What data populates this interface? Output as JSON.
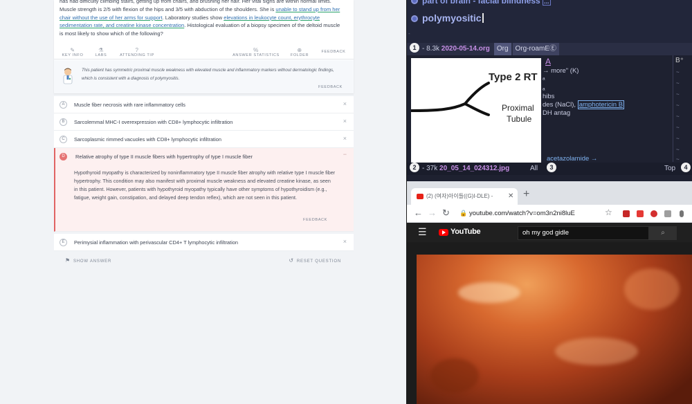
{
  "question": {
    "stem_parts": [
      {
        "text": "has had difficulty climbing stairs, getting up from chairs, and brushing her hair. Her vital signs are within normal limits. Muscle strength is 2/5 with flexion of the hips and 3/5 with abduction of the shoulders. She is ",
        "hl": false
      },
      {
        "text": "unable to stand up from her chair without the use of her arms for support",
        "hl": true
      },
      {
        "text": ". Laboratory studies show ",
        "hl": false
      },
      {
        "text": "elevations in leukocyte count, erythrocyte sedimentation rate, and creatine kinase concentration",
        "hl": true
      },
      {
        "text": ". Histological evaluation of a biopsy specimen of the deltoid muscle is most likely to show which of the following?",
        "hl": false
      }
    ],
    "toolbar": {
      "key_info": "KEY INFO",
      "labs": "LABS",
      "attending_tip": "ATTENDING TIP",
      "answer_statistics": "ANSWER STATISTICS",
      "folder": "FOLDER",
      "feedback": "FEEDBACK"
    },
    "explanation": "This patient has symmetric proximal muscle weakness with elevated muscle and inflammatory markers without dermatologic findings, which is consistent with a diagnosis of polymyositis.",
    "explanation_feedback": "FEEDBACK"
  },
  "answers": [
    {
      "letter": "A",
      "text": "Muscle fiber necrosis with rare inflammatory cells"
    },
    {
      "letter": "B",
      "text": "Sarcolemmal MHC-I overexpression with CD8+ lymphocytic infiltration"
    },
    {
      "letter": "C",
      "text": "Sarcoplasmic rimmed vacuoles with CD8+ lymphocytic infiltration"
    },
    {
      "letter": "D",
      "text": "Relative atrophy of type II muscle fibers with hypertrophy of type I muscle fiber",
      "selected": true,
      "explanation": "Hypothyroid myopathy is characterized by noninflammatory type II muscle fiber atrophy with relative type I muscle fiber hypertrophy. This condition may also manifest with proximal muscle weakness and elevated creatine kinase, as seen in this patient. However, patients with hypothyroid myopathy typically have other symptoms of hypothyroidism (e.g., fatigue, weight gain, constipation, and delayed deep tendon reflex), which are not seen in this patient.",
      "feedback": "FEEDBACK"
    },
    {
      "letter": "E",
      "text": "Perimysial inflammation with perivascular CD4+ T lymphocytic infiltration"
    }
  ],
  "bottom": {
    "show_answer": "SHOW ANSWER",
    "reset_question": "RESET QUESTION"
  },
  "emacs": {
    "heading1": "part of brain - facial blindness",
    "heading1_suffix": "...",
    "heading2": "polymyositic",
    "modeline1": {
      "window_num": "1",
      "size": "- 8.3k",
      "file": "2020-05-14.org",
      "mode": "Org",
      "minor": "Org-roam",
      "minor_suffix": "EⒺ"
    },
    "image_labels": {
      "title": "Type 2 RT",
      "sub1": "Proximal",
      "sub2": "Tubule"
    },
    "side_lines": [
      "A",
      "→ more\" (K)",
      "",
      "hibs",
      "des (NaCl), ",
      "DH antag",
      "",
      "",
      "",
      "acetazolamide →"
    ],
    "side_link": "amphotericin B",
    "modeline2": {
      "window_num": "2",
      "size": "- 37k",
      "file": "20_05_14_024312.jpg",
      "all": "All",
      "window_num3": "3",
      "top": "Top",
      "window_num4": "4"
    }
  },
  "browser": {
    "tab_title": "(2) (여자)아이들((G)I-DLE) -",
    "url": "youtube.com/watch?v=om3n2ni8luE",
    "youtube_logo": "YouTube",
    "search_value": "oh my god gidle"
  }
}
